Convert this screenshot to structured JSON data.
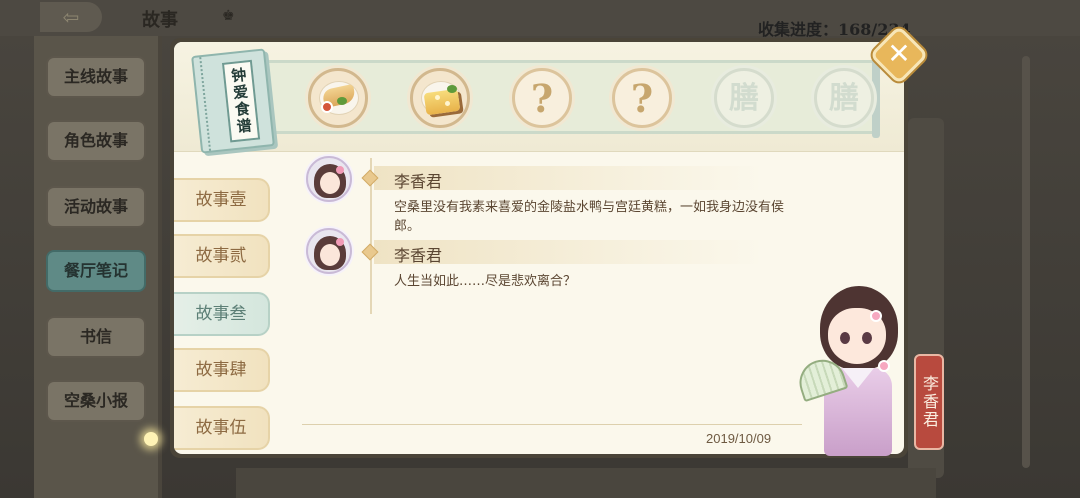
{
  "header": {
    "title": "故事",
    "progress_label": "收集进度：168/234"
  },
  "sidebar": {
    "items": [
      {
        "label": "主线故事"
      },
      {
        "label": "角色故事"
      },
      {
        "label": "活动故事"
      },
      {
        "label": "餐厅笔记",
        "active": true
      },
      {
        "label": "书信"
      },
      {
        "label": "空桑小报"
      }
    ]
  },
  "modal": {
    "menu_label": "钟爱食谱",
    "dishes": [
      {
        "icon": "dish-duck-icon",
        "state": "unlocked"
      },
      {
        "icon": "dish-cake-icon",
        "state": "unlocked"
      },
      {
        "icon": "question-mark-icon",
        "state": "unknown",
        "mark": "?"
      },
      {
        "icon": "question-mark-icon",
        "state": "unknown",
        "mark": "?"
      },
      {
        "icon": "locked-dish-icon",
        "state": "locked",
        "mark": "膳"
      },
      {
        "icon": "locked-dish-icon",
        "state": "locked",
        "mark": "膳"
      }
    ],
    "tabs": [
      {
        "label": "故事壹"
      },
      {
        "label": "故事贰"
      },
      {
        "label": "故事叁",
        "active": true
      },
      {
        "label": "故事肆"
      },
      {
        "label": "故事伍"
      }
    ],
    "dialogue": [
      {
        "speaker": "李香君",
        "text": "空桑里没有我素来喜爱的金陵盐水鸭与宫廷黄糕，一如我身边没有侯郎。"
      },
      {
        "speaker": "李香君",
        "text": "人生当如此……尽是悲欢离合？"
      }
    ],
    "date": "2019/10/09",
    "close_label": "✕",
    "character_name": "李香君"
  },
  "colors": {
    "accent_gold": "#e8b75b",
    "active_tab": "#d4e6dd",
    "nametag": "#b84a3e"
  }
}
